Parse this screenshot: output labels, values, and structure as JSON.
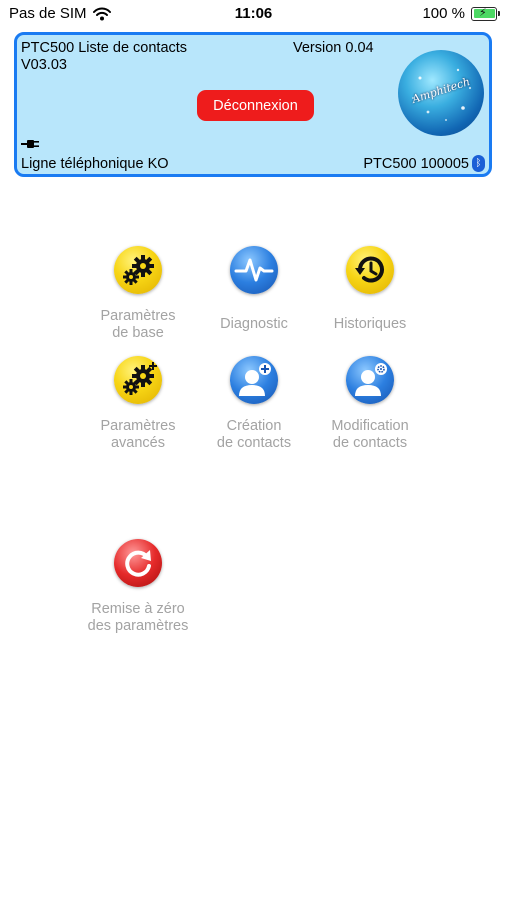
{
  "status_bar": {
    "carrier": "Pas de SIM",
    "time": "11:06",
    "battery": "100 %"
  },
  "header": {
    "title": "PTC500 Liste de contacts",
    "version": "Version 0.04",
    "firmware": "V03.03",
    "disconnect_label": "Déconnexion",
    "logo_text": "Amphitech",
    "line_status": "Ligne téléphonique KO",
    "device": "PTC500 100005"
  },
  "menu": {
    "items": [
      {
        "label": "Paramètres\nde base",
        "icon": "gears-icon"
      },
      {
        "label": "Diagnostic",
        "icon": "pulse-icon"
      },
      {
        "label": "Historiques",
        "icon": "history-icon"
      },
      {
        "label": "Paramètres\navancés",
        "icon": "gears-plus-icon"
      },
      {
        "label": "Création\nde contacts",
        "icon": "add-contact-icon"
      },
      {
        "label": "Modification\nde contacts",
        "icon": "edit-contact-icon"
      },
      {
        "label": "Remise à zéro\ndes paramètres",
        "icon": "reset-icon"
      }
    ]
  },
  "colors": {
    "header_bg": "#b8e6fb",
    "header_border": "#1a7bf2",
    "button_red": "#ee1c1c",
    "label_gray": "#a3a3a3"
  }
}
